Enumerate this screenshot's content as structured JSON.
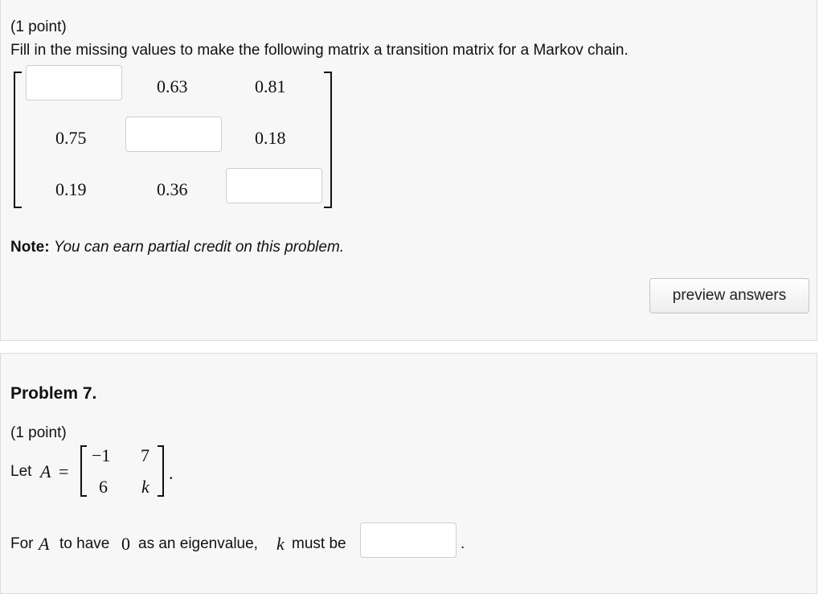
{
  "problem6": {
    "points": "(1 point)",
    "statement": "Fill in the missing values to make the following matrix a transition matrix for a Markov chain.",
    "matrix": {
      "r1c2": "0.63",
      "r1c3": "0.81",
      "r2c1": "0.75",
      "r2c3": "0.18",
      "r3c1": "0.19",
      "r3c2": "0.36"
    },
    "answers": {
      "r1c1": "",
      "r2c2": "",
      "r3c3": ""
    },
    "note_label": "Note:",
    "note_text": "You can earn partial credit on this problem.",
    "preview_button": "preview answers"
  },
  "problem7": {
    "title": "Problem 7.",
    "points": "(1 point)",
    "let_prefix": "Let",
    "var_A": "A",
    "equals": "=",
    "matrix": {
      "r1c1": "−1",
      "r1c2": "7",
      "r2c1": "6",
      "r2c2": "k"
    },
    "period": ".",
    "q_for": "For",
    "q_A": "A",
    "q_to_have": "to have",
    "q_zero": "0",
    "q_as_eigen": "as an eigenvalue,",
    "q_k": "k",
    "q_must_be": "must be",
    "answer": "",
    "q_end": "."
  }
}
